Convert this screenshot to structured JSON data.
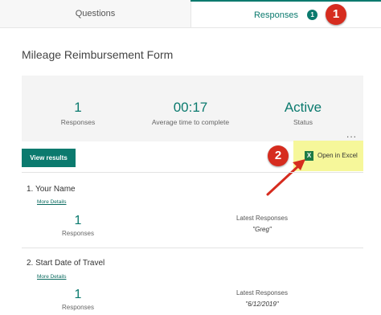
{
  "tabs": {
    "questions_label": "Questions",
    "responses_label": "Responses",
    "responses_badge": "1"
  },
  "annotations": {
    "step1": "1",
    "step2": "2"
  },
  "form": {
    "title": "Mileage Reimbursement Form"
  },
  "summary": {
    "responses_value": "1",
    "responses_label": "Responses",
    "avg_time_value": "00:17",
    "avg_time_label": "Average time to complete",
    "status_value": "Active",
    "status_label": "Status",
    "more_dots": "..."
  },
  "actions": {
    "view_results_label": "View results",
    "open_excel_label": "Open in Excel",
    "excel_icon": "X"
  },
  "questions": [
    {
      "title": "1.  Your Name",
      "more_details": "More Details",
      "count": "1",
      "count_label": "Responses",
      "latest_label": "Latest Responses",
      "latest_value": "\"Greg\""
    },
    {
      "title": "2.  Start Date of Travel",
      "more_details": "More Details",
      "count": "1",
      "count_label": "Responses",
      "latest_label": "Latest Responses",
      "latest_value": "\"6/12/2019\""
    }
  ],
  "colors": {
    "accent": "#0b7a6e",
    "annotation": "#d62c1f",
    "highlight": "#f6f79a"
  }
}
